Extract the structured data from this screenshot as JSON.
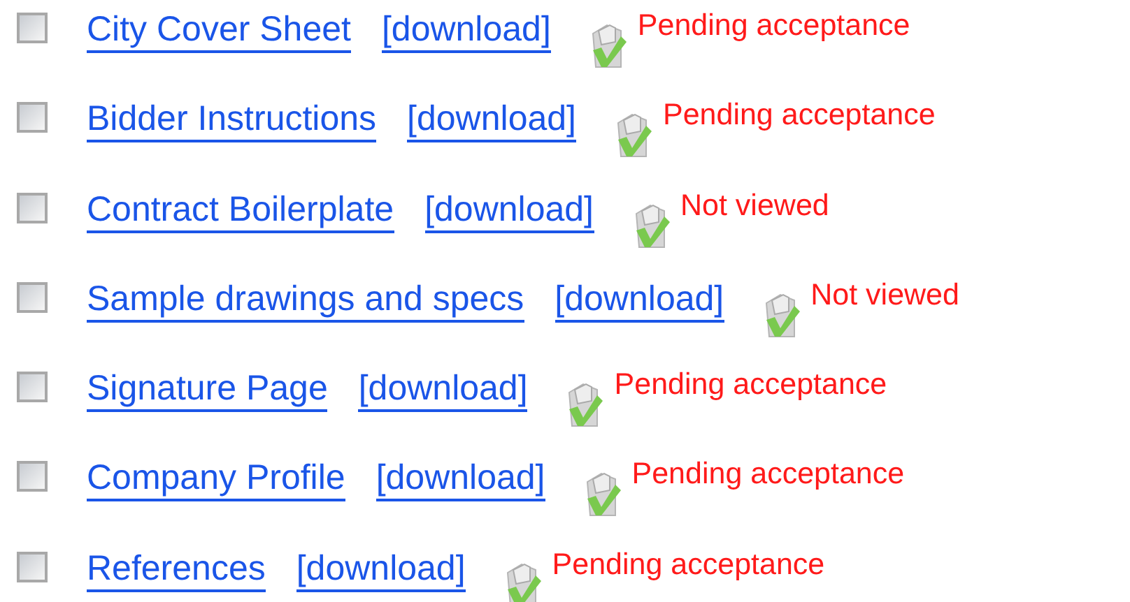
{
  "documents": [
    {
      "title": "City Cover Sheet",
      "download": "[download]",
      "status": "Pending acceptance",
      "checked": false
    },
    {
      "title": "Bidder Instructions",
      "download": "[download]",
      "status": "Pending acceptance",
      "checked": false
    },
    {
      "title": "Contract Boilerplate",
      "download": "[download]",
      "status": "Not viewed",
      "checked": false
    },
    {
      "title": "Sample drawings and specs",
      "download": "[download]",
      "status": "Not viewed",
      "checked": false
    },
    {
      "title": "Signature Page",
      "download": "[download]",
      "status": "Pending acceptance",
      "checked": false
    },
    {
      "title": "Company Profile",
      "download": "[download]",
      "status": "Pending acceptance",
      "checked": false
    },
    {
      "title": "References",
      "download": "[download]",
      "status": "Pending acceptance",
      "checked": false
    }
  ]
}
